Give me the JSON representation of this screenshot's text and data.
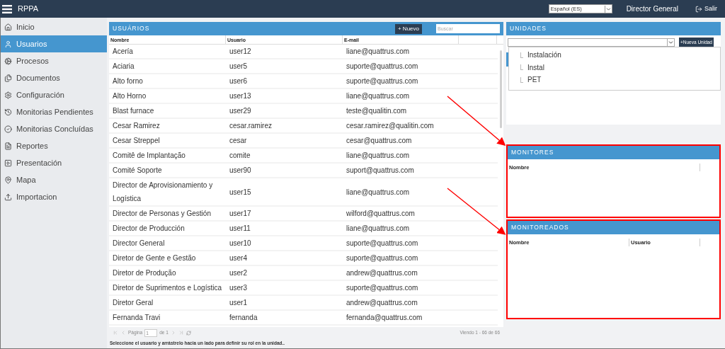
{
  "header": {
    "app_name": "RPPA",
    "language": "Español (ES)",
    "user": "Director General",
    "logout": "Salir"
  },
  "sidebar": {
    "items": [
      {
        "label": "Inicio",
        "selected": false
      },
      {
        "label": "Usuarios",
        "selected": true
      },
      {
        "label": "Procesos",
        "selected": false
      },
      {
        "label": "Documentos",
        "selected": false
      },
      {
        "label": "Configuración",
        "selected": false
      },
      {
        "label": "Monitorias Pendientes",
        "selected": false
      },
      {
        "label": "Monitorias Concluídas",
        "selected": false
      },
      {
        "label": "Reportes",
        "selected": false
      },
      {
        "label": "Presentación",
        "selected": false
      },
      {
        "label": "Mapa",
        "selected": false
      },
      {
        "label": "Importacion",
        "selected": false
      }
    ]
  },
  "users_panel": {
    "title": "USUÁRIOS",
    "new_button": "+ Nuevo",
    "search": {
      "placeholder": "Buscar"
    },
    "columns": [
      "Nombre",
      "Usuario",
      "E-mail"
    ],
    "rows": [
      [
        "Acería",
        "user12",
        "liane@quattrus.com"
      ],
      [
        "Aciaria",
        "user5",
        "suporte@quattrus.com"
      ],
      [
        "Alto forno",
        "user6",
        "suporte@quattrus.com"
      ],
      [
        "Alto Horno",
        "user13",
        "liane@quattrus.com"
      ],
      [
        "Blast furnace",
        "user29",
        "teste@qualitin.com"
      ],
      [
        "Cesar Ramirez",
        "cesar.ramirez",
        "cesar.ramirez@qualitin.com"
      ],
      [
        "Cesar Streppel",
        "cesar",
        "cesar@quattrus.com"
      ],
      [
        "Comitê de Implantação",
        "comite",
        "liane@quattrus.com"
      ],
      [
        "Comité Soporte",
        "user90",
        "suport@quattrus.com"
      ],
      [
        "Director de Aprovisionamiento y Logística",
        "user15",
        "liane@quattrus.com"
      ],
      [
        "Director de Personas y Gestión",
        "user17",
        "wilford@quattrus.com"
      ],
      [
        "Director de Producción",
        "user11",
        "liane@quattrus.com"
      ],
      [
        "Director General",
        "user10",
        "suporte@quattrus.com"
      ],
      [
        "Diretor de Gente e Gestão",
        "user4",
        "suporte@quattrus.com"
      ],
      [
        "Diretor de Produção",
        "user2",
        "andrew@quattrus.com"
      ],
      [
        "Diretor de Suprimentos e Logística",
        "user3",
        "suporte@quattrus.com"
      ],
      [
        "Diretor Geral",
        "user1",
        "andrew@quattrus.com"
      ],
      [
        "Fernanda Travi",
        "fernanda",
        "fernanda@quattrus.com"
      ]
    ],
    "pager": {
      "page_label": "Página",
      "page": "1",
      "of": "de 1",
      "summary": "Viendo 1 - 66 de 66"
    },
    "hint": "Seleccione el usuario y arrástrelo hacia un lado para definir su rol en la unidad.."
  },
  "units_panel": {
    "title": "UNIDADES",
    "new_button": "+Nueva Unidad",
    "tree": [
      {
        "label": "Instalación"
      },
      {
        "label": "Instal"
      },
      {
        "label": "PET"
      }
    ]
  },
  "monitors_panel": {
    "title": "MONITORES",
    "highlighted": true,
    "columns": [
      "Nombre"
    ]
  },
  "monitored_panel": {
    "title": "MONITOREADOS",
    "highlighted": true,
    "columns": [
      "Nombre",
      "Usuario"
    ]
  }
}
